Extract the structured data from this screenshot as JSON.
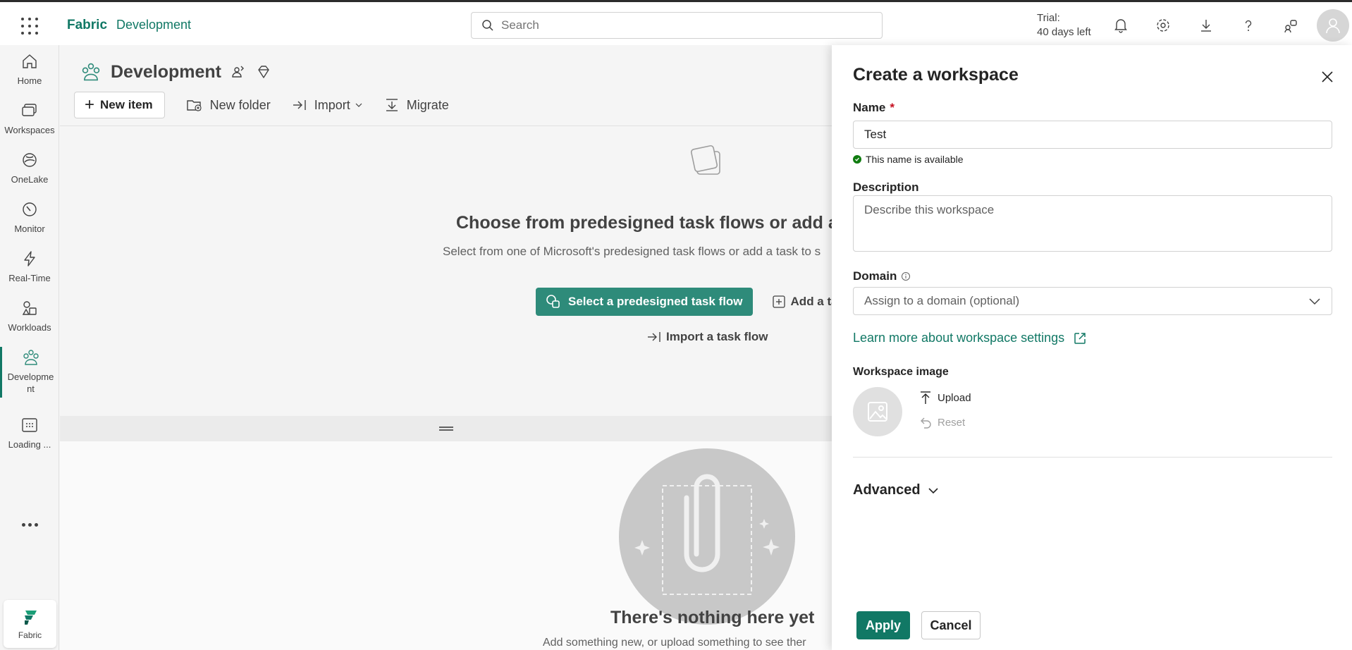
{
  "topbar": {
    "brand": "Fabric",
    "workspace": "Development",
    "search_placeholder": "Search",
    "trial_line1": "Trial:",
    "trial_line2": "40 days left"
  },
  "rail": {
    "items": [
      {
        "label": "Home",
        "icon": "home-icon"
      },
      {
        "label": "Workspaces",
        "icon": "workspaces-icon"
      },
      {
        "label": "OneLake",
        "icon": "onelake-icon"
      },
      {
        "label": "Monitor",
        "icon": "monitor-icon"
      },
      {
        "label": "Real-Time",
        "icon": "realtime-icon"
      },
      {
        "label": "Workloads",
        "icon": "workloads-icon"
      },
      {
        "label_line1": "Developme",
        "label_line2": "nt",
        "icon": "workspace-people-icon"
      },
      {
        "label": "Loading ...",
        "icon": "loading-icon"
      }
    ],
    "fabric_label": "Fabric"
  },
  "main": {
    "title": "Development",
    "toolbar": {
      "new_item": "New item",
      "new_folder": "New folder",
      "import": "Import",
      "migrate": "Migrate"
    },
    "taskflow": {
      "title": "Choose from predesigned task flows or add a ta",
      "subtitle": "Select from one of Microsoft's predesigned task flows or add a task to s",
      "select_button": "Select a predesigned task flow",
      "add_button": "Add a ta",
      "import_link": "Import a task flow"
    },
    "empty": {
      "title": "There's nothing here yet",
      "subtitle": "Add something new, or upload something to see ther"
    }
  },
  "panel": {
    "title": "Create a workspace",
    "name_label": "Name",
    "required_mark": "*",
    "name_value": "Test",
    "name_status": "This name is available",
    "description_label": "Description",
    "description_placeholder": "Describe this workspace",
    "domain_label": "Domain",
    "domain_placeholder": "Assign to a domain (optional)",
    "learn_more": "Learn more about workspace settings",
    "image_label": "Workspace image",
    "upload": "Upload",
    "reset": "Reset",
    "advanced": "Advanced",
    "apply": "Apply",
    "cancel": "Cancel"
  },
  "colors": {
    "brand": "#117865",
    "primary_button": "#117865",
    "taskflow_button": "#2e8b7a",
    "success": "#107c10",
    "required": "#c50f1f"
  }
}
